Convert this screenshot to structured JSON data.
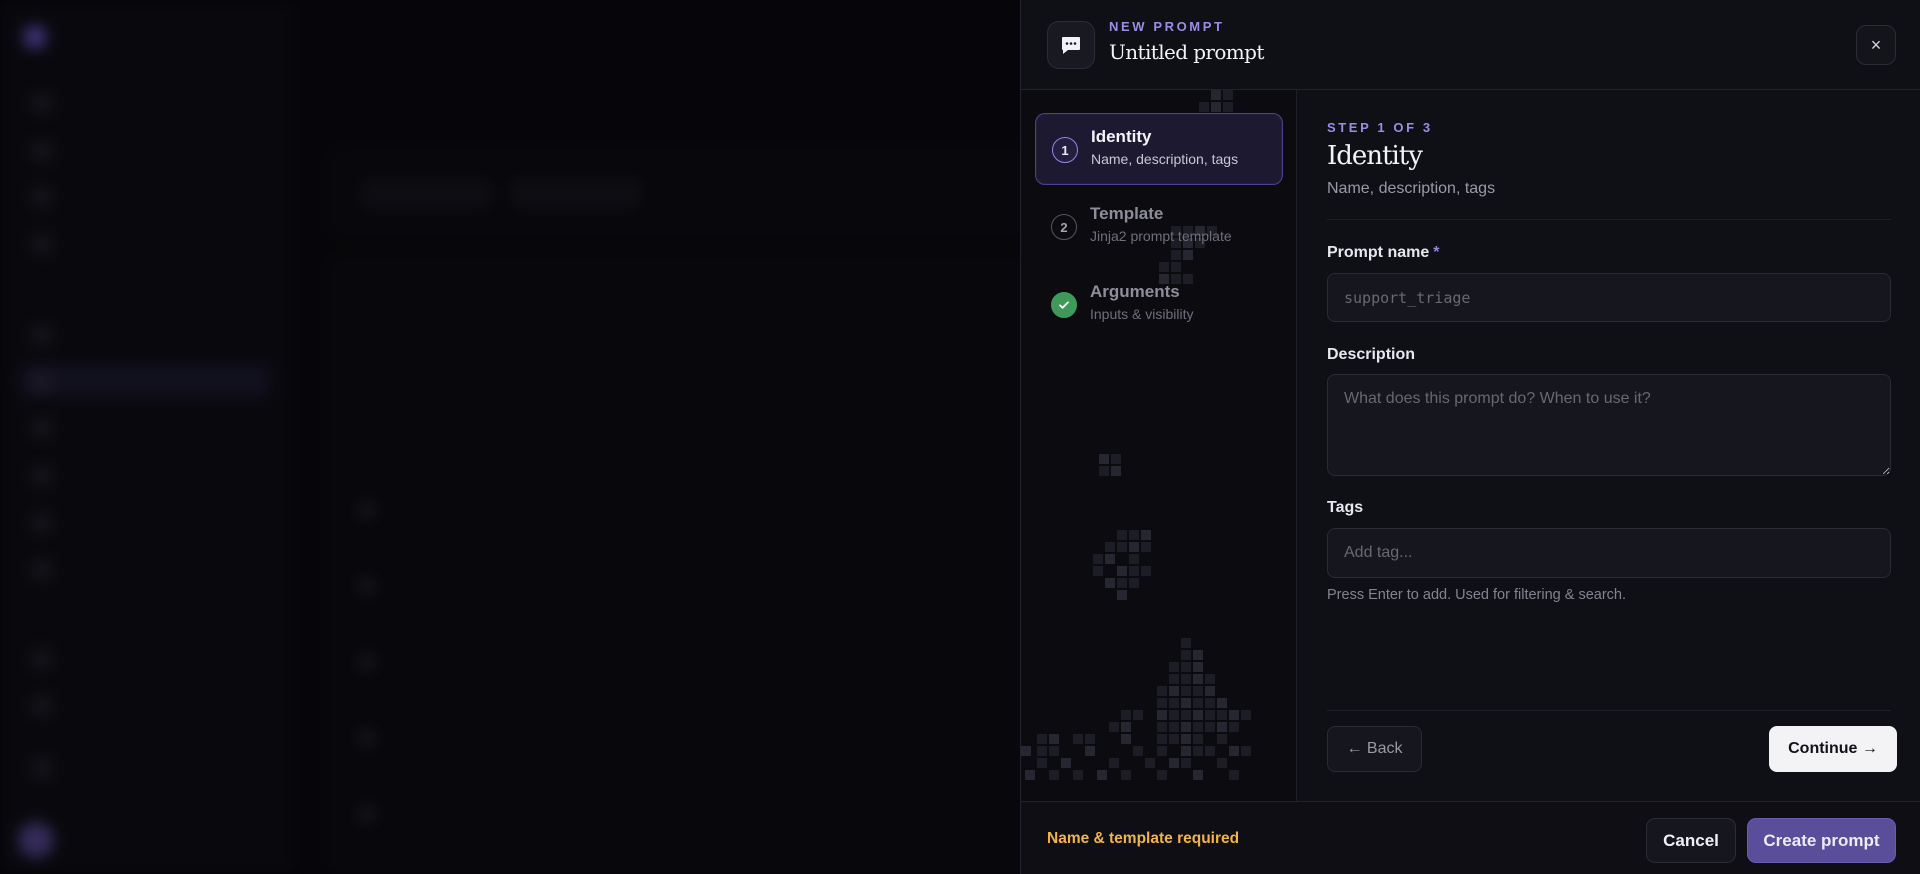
{
  "drawer": {
    "kicker": "NEW PROMPT",
    "title": "Untitled prompt",
    "header_icon": "message-square-icon",
    "close_icon": "close-icon",
    "close_label": "×"
  },
  "steps": [
    {
      "number": "1",
      "title": "Identity",
      "subtitle": "Name, description, tags",
      "state": "active"
    },
    {
      "number": "2",
      "title": "Template",
      "subtitle": "Jinja2 prompt template",
      "state": "pending"
    },
    {
      "number": "3",
      "title": "Arguments",
      "subtitle": "Inputs & visibility",
      "state": "done",
      "icon": "check-icon"
    }
  ],
  "form": {
    "step_label": "STEP 1 OF 3",
    "title": "Identity",
    "subtitle": "Name, description, tags",
    "name": {
      "label": "Prompt name",
      "required_mark": "*",
      "value": "",
      "placeholder": "support_triage"
    },
    "description": {
      "label": "Description",
      "value": "",
      "placeholder": "What does this prompt do? When to use it?"
    },
    "tags": {
      "label": "Tags",
      "value": "",
      "placeholder": "Add tag...",
      "hint": "Press Enter to add. Used for filtering & search."
    },
    "back_label": "← Back",
    "continue_label": "Continue →"
  },
  "footer": {
    "warning": "Name & template required",
    "cancel_label": "Cancel",
    "create_label": "Create prompt"
  },
  "colors": {
    "accent": "#9585e6",
    "primary_button": "#5a4d99",
    "success": "#3f9a5a",
    "warning": "#f2b544",
    "panel": "#0f0f16"
  }
}
